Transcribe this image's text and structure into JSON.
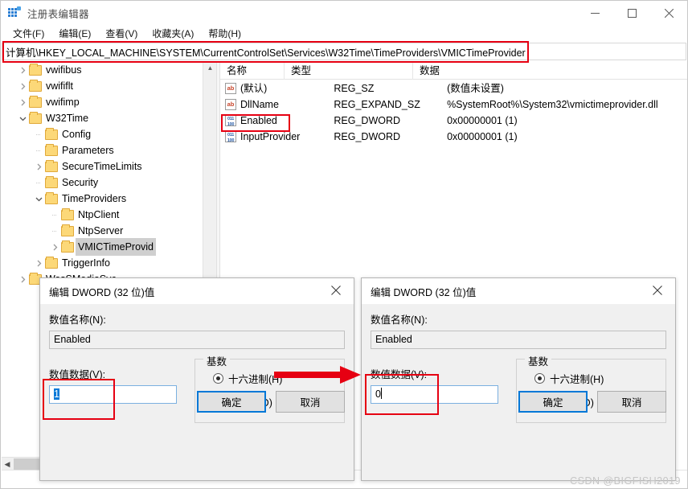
{
  "window": {
    "title": "注册表编辑器",
    "icon": "registry-editor-icon",
    "minimize_label": "最小化",
    "maximize_label": "最大化",
    "close_label": "关闭"
  },
  "menubar": {
    "items": [
      {
        "label": "文件(F)"
      },
      {
        "label": "编辑(E)"
      },
      {
        "label": "查看(V)"
      },
      {
        "label": "收藏夹(A)"
      },
      {
        "label": "帮助(H)"
      }
    ]
  },
  "address": {
    "path": "计算机\\HKEY_LOCAL_MACHINE\\SYSTEM\\CurrentControlSet\\Services\\W32Time\\TimeProviders\\VMICTimeProvider"
  },
  "tree": {
    "nodes": [
      {
        "label": "vwifibus",
        "indent": 2,
        "expander": "collapsed",
        "selected": false
      },
      {
        "label": "vwififlt",
        "indent": 2,
        "expander": "collapsed",
        "selected": false
      },
      {
        "label": "vwifimp",
        "indent": 2,
        "expander": "collapsed",
        "selected": false
      },
      {
        "label": "W32Time",
        "indent": 2,
        "expander": "expanded",
        "selected": false
      },
      {
        "label": "Config",
        "indent": 3,
        "expander": "none",
        "selected": false
      },
      {
        "label": "Parameters",
        "indent": 3,
        "expander": "none",
        "selected": false
      },
      {
        "label": "SecureTimeLimits",
        "indent": 3,
        "expander": "collapsed",
        "selected": false
      },
      {
        "label": "Security",
        "indent": 3,
        "expander": "none",
        "selected": false
      },
      {
        "label": "TimeProviders",
        "indent": 3,
        "expander": "expanded",
        "selected": false
      },
      {
        "label": "NtpClient",
        "indent": 4,
        "expander": "none",
        "selected": false
      },
      {
        "label": "NtpServer",
        "indent": 4,
        "expander": "none",
        "selected": false
      },
      {
        "label": "VMICTimeProvid",
        "indent": 4,
        "expander": "collapsed",
        "selected": true
      },
      {
        "label": "TriggerInfo",
        "indent": 3,
        "expander": "collapsed",
        "selected": false
      },
      {
        "label": "WasSMediaSvc",
        "indent": 2,
        "expander": "collapsed",
        "selected": false
      }
    ]
  },
  "values": {
    "columns": [
      "名称",
      "类型",
      "数据"
    ],
    "rows": [
      {
        "icon": "string-value-icon",
        "name": "(默认)",
        "type": "REG_SZ",
        "data": "(数值未设置)"
      },
      {
        "icon": "string-value-icon",
        "name": "DllName",
        "type": "REG_EXPAND_SZ",
        "data": "%SystemRoot%\\System32\\vmictimeprovider.dll"
      },
      {
        "icon": "dword-value-icon",
        "name": "Enabled",
        "type": "REG_DWORD",
        "data": "0x00000001 (1)"
      },
      {
        "icon": "dword-value-icon",
        "name": "InputProvider",
        "type": "REG_DWORD",
        "data": "0x00000001 (1)"
      }
    ]
  },
  "dialog_before": {
    "title": "编辑 DWORD (32 位)值",
    "close_label": "✕",
    "name_label": "数值名称(N):",
    "name_value": "Enabled",
    "data_label": "数值数据(V):",
    "data_value": "1",
    "base_group_label": "基数",
    "radio_hex": "十六进制(H)",
    "radio_dec": "十进制(D)",
    "base_selected": "hex",
    "ok_label": "确定",
    "cancel_label": "取消"
  },
  "dialog_after": {
    "title": "编辑 DWORD (32 位)值",
    "close_label": "✕",
    "name_label": "数值名称(N):",
    "name_value": "Enabled",
    "data_label": "数值数据(V):",
    "data_value": "0",
    "base_group_label": "基数",
    "radio_hex": "十六进制(H)",
    "radio_dec": "十进制(D)",
    "base_selected": "hex",
    "ok_label": "确定",
    "cancel_label": "取消"
  },
  "annotations": {
    "highlight_color": "#e60012",
    "arrow_color": "#e60012",
    "arrow_direction": "right"
  },
  "watermark": {
    "text": "CSDN @BIGFISH2019"
  }
}
